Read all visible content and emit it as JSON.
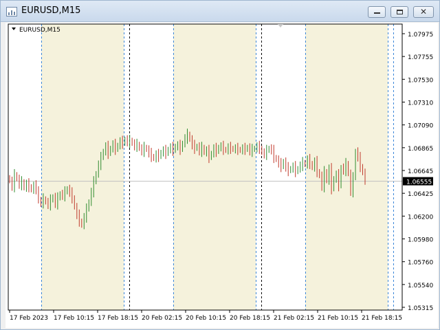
{
  "window": {
    "title": "EURUSD,M15",
    "buttons": {
      "minimize": "minimize",
      "maximize": "maximize",
      "close": "✕"
    }
  },
  "chart_data": {
    "type": "candlestick",
    "symbol_label": "EURUSD,M15",
    "current_price": "1.06555",
    "ylim": [
      1.0528,
      1.0811
    ],
    "price_ticks": [
      "1.07975",
      "1.07755",
      "1.07530",
      "1.07310",
      "1.07090",
      "1.06865",
      "1.06645",
      "1.06425",
      "1.06200",
      "1.05980",
      "1.05760",
      "1.05540",
      "1.05315"
    ],
    "time_labels": [
      "17 Feb 2023",
      "17 Feb 10:15",
      "17 Feb 18:15",
      "20 Feb 02:15",
      "20 Feb 10:15",
      "20 Feb 18:15",
      "21 Feb 02:15",
      "21 Feb 10:15",
      "21 Feb 18:15"
    ],
    "colors": {
      "up": "#2e8b2e",
      "down": "#c0392b",
      "session_shade": "#f5f2dc",
      "session_line": "#3a86d8",
      "day_line": "#000000",
      "current_price_bg": "#000000",
      "current_price_text": "#ffffff",
      "axis": "#000000",
      "price_line": "#c0c0c0"
    },
    "closes": [
      1.0656,
      1.065,
      1.0662,
      1.0658,
      1.0652,
      1.0655,
      1.0649,
      1.0653,
      1.065,
      1.0647,
      1.0651,
      1.0648,
      1.0636,
      1.0634,
      1.0638,
      1.0635,
      1.0632,
      1.0637,
      1.064,
      1.0633,
      1.0639,
      1.0643,
      1.0641,
      1.0645,
      1.0648,
      1.0644,
      1.0639,
      1.063,
      1.0622,
      1.0616,
      1.0612,
      1.062,
      1.0628,
      1.0635,
      1.0645,
      1.0655,
      1.0663,
      1.0672,
      1.0679,
      1.0685,
      1.069,
      1.0683,
      1.0688,
      1.0692,
      1.0687,
      1.0691,
      1.0695,
      1.0693,
      1.0697,
      1.0694,
      1.0696,
      1.0693,
      1.069,
      1.0692,
      1.0688,
      1.0685,
      1.0689,
      1.0687,
      1.0683,
      1.068,
      1.0678,
      1.0682,
      1.068,
      1.0684,
      1.0686,
      1.0683,
      1.0687,
      1.0689,
      1.0686,
      1.069,
      1.0691,
      1.0687,
      1.0693,
      1.0698,
      1.0702,
      1.0697,
      1.0691,
      1.0688,
      1.069,
      1.0685,
      1.0689,
      1.0684,
      1.0686,
      1.0679,
      1.0683,
      1.0688,
      1.0685,
      1.0689,
      1.069,
      1.0687,
      1.0686,
      1.0689,
      1.0688,
      1.0687,
      1.0688,
      1.0687,
      1.0686,
      1.0688,
      1.0687,
      1.0689,
      1.0685,
      1.0687,
      1.0688,
      1.069,
      1.0688,
      1.0684,
      1.0682,
      1.0686,
      1.0688,
      1.0686,
      1.0679,
      1.0677,
      1.0673,
      1.067,
      1.0675,
      1.0669,
      1.0666,
      1.0668,
      1.067,
      1.0665,
      1.0668,
      1.0671,
      1.0674,
      1.0672,
      1.0677,
      1.0673,
      1.0669,
      1.0675,
      1.0665,
      1.0661,
      1.065,
      1.0665,
      1.0656,
      1.0668,
      1.0648,
      1.0658,
      1.0662,
      1.0651,
      1.0669,
      1.0666,
      1.0673,
      1.0663,
      1.0645,
      1.0659,
      1.0685,
      1.0679,
      1.067,
      1.0664,
      1.0656
    ]
  }
}
